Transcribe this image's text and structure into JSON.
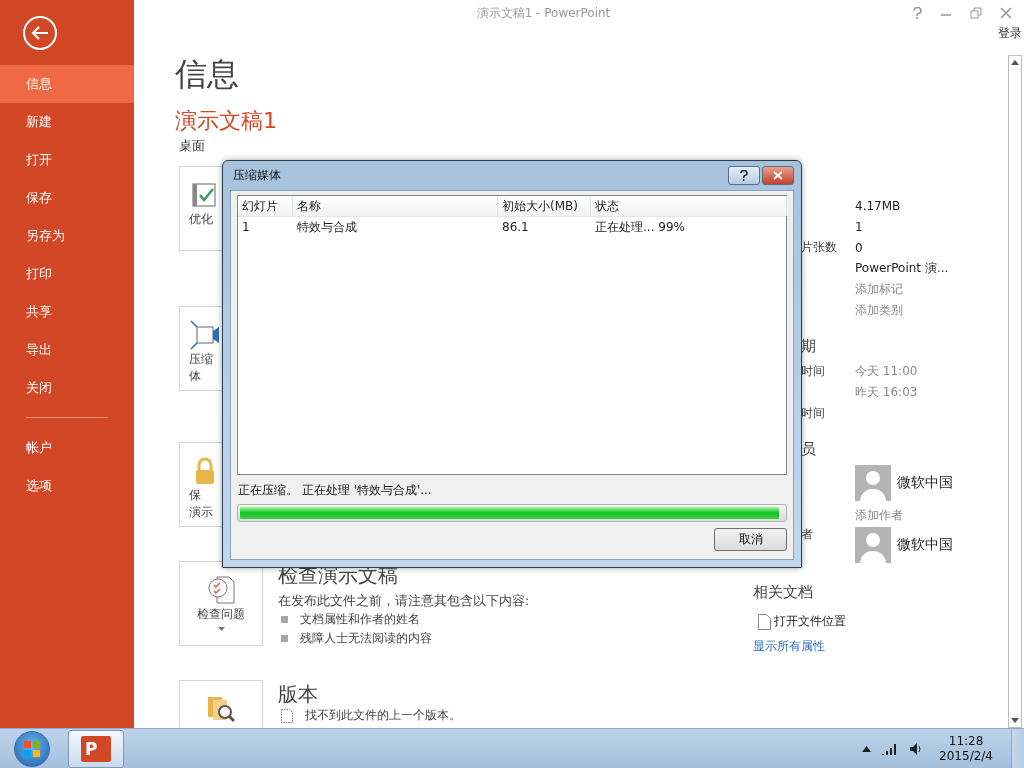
{
  "window": {
    "title": "演示文稿1 - PowerPoint",
    "sign_in": "登录"
  },
  "sidebar": {
    "sections": [
      {
        "items": [
          {
            "label": "信息",
            "selected": true
          },
          {
            "label": "新建",
            "selected": false
          },
          {
            "label": "打开",
            "selected": false
          },
          {
            "label": "保存",
            "selected": false
          },
          {
            "label": "另存为",
            "selected": false
          },
          {
            "label": "打印",
            "selected": false
          },
          {
            "label": "共享",
            "selected": false
          },
          {
            "label": "导出",
            "selected": false
          },
          {
            "label": "关闭",
            "selected": false
          }
        ]
      },
      {
        "items": [
          {
            "label": "帐户",
            "selected": false
          },
          {
            "label": "选项",
            "selected": false
          }
        ]
      }
    ]
  },
  "page": {
    "heading": "信息",
    "doc_title": "演示文稿1",
    "location": "桌面"
  },
  "tools": [
    {
      "kind": "optimize",
      "label_lines": [
        "优化"
      ]
    },
    {
      "kind": "compress",
      "label_lines": [
        "压缩",
        "体"
      ]
    },
    {
      "kind": "protect",
      "label_lines": [
        "保",
        "演示"
      ]
    },
    {
      "kind": "inspect",
      "label_lines": [
        "检查问题"
      ],
      "dropdown": true,
      "title": "检查演示文稿",
      "description": "在发布此文件之前，请注意其包含以下内容:",
      "items": [
        {
          "kind": "bullet",
          "text": "文档属性和作者的姓名"
        },
        {
          "kind": "bullet",
          "text": "残障人士无法阅读的内容"
        }
      ]
    },
    {
      "kind": "versions",
      "title": "版本",
      "items": [
        {
          "kind": "note",
          "text": "找不到此文件的上一个版本。"
        }
      ]
    }
  ],
  "properties": [
    {
      "kind": "props",
      "rows": [
        {
          "kind": "value",
          "value": "4.17MB"
        },
        {
          "kind": "value",
          "value": "1"
        },
        {
          "kind": "value",
          "label": "片张数",
          "value": "0"
        },
        {
          "kind": "value",
          "value": "PowerPoint 演..."
        },
        {
          "kind": "hint",
          "value": "添加标记"
        },
        {
          "kind": "hint",
          "value": "添加类别"
        }
      ]
    },
    {
      "kind": "props",
      "heading": "期",
      "rows": [
        {
          "kind": "hint",
          "label": "时间",
          "value": "今天 11:00"
        },
        {
          "kind": "hint",
          "value": "昨天 16:03"
        },
        {
          "kind": "hint",
          "label": "时间"
        }
      ]
    },
    {
      "kind": "props",
      "heading": "员",
      "rows": [
        {
          "kind": "person",
          "value": "微软中国"
        },
        {
          "kind": "hint",
          "value": "添加作者"
        },
        {
          "kind": "person",
          "label": "者",
          "value": "微软中国"
        }
      ]
    },
    {
      "kind": "related",
      "heading": "相关文档",
      "rows": [
        {
          "kind": "file",
          "value": "打开文件位置"
        }
      ],
      "link": "显示所有属性"
    }
  ],
  "dialog": {
    "title": "压缩媒体",
    "columns": [
      "幻灯片",
      "名称",
      "初始大小(MB)",
      "状态"
    ],
    "rows": [
      [
        "1",
        "特效与合成",
        "86.1",
        "正在处理... 99%"
      ]
    ],
    "status": "正在压缩。 正在处理 '特效与合成'...",
    "level": 0.99,
    "button": "取消"
  },
  "taskbar": {
    "apps": [
      {
        "logo_letter": "P",
        "selected": true
      }
    ],
    "time": "11:28",
    "date": "2015/2/4"
  }
}
